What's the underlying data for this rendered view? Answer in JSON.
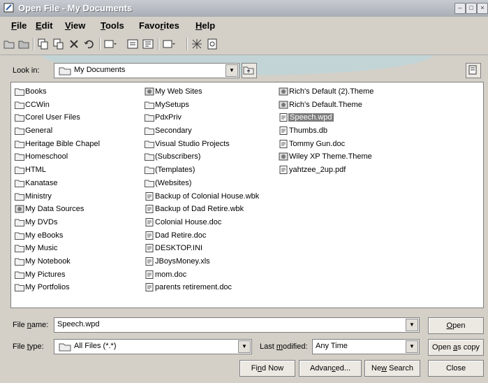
{
  "window": {
    "title": "Open File - My Documents"
  },
  "menu": [
    {
      "label": "File",
      "ul": "F",
      "rest": "ile"
    },
    {
      "label": "Edit",
      "ul": "E",
      "rest": "dit"
    },
    {
      "label": "View",
      "ul": "V",
      "rest": "iew"
    },
    {
      "label": "Tools",
      "ul": "T",
      "rest": "ools"
    },
    {
      "label": "Favorites",
      "pre": "Favo",
      "ul": "r",
      "rest": "ites"
    },
    {
      "label": "Help",
      "ul": "H",
      "rest": "elp"
    }
  ],
  "lookin": {
    "label": "Look in:",
    "value": "My Documents"
  },
  "files": {
    "col1": [
      "Books",
      "CCWin",
      "Corel User Files",
      "General",
      "Heritage Bible Chapel",
      "Homeschool",
      "HTML",
      "Kanatase",
      "Ministry",
      "My Data Sources",
      "My DVDs",
      "My eBooks",
      "My Music",
      "My Notebook",
      "My Pictures",
      "My Portfolios"
    ],
    "col2": [
      "My Web Sites",
      "MySetups",
      "PdxPriv",
      "Secondary",
      "Visual Studio Projects",
      "(Subscribers)",
      "(Templates)",
      "(Websites)",
      "Backup of Colonial House.wbk",
      "Backup of Dad Retire.wbk",
      "Colonial House.doc",
      "Dad Retire.doc",
      "DESKTOP.INI",
      "JBoysMoney.xls",
      "mom.doc",
      "parents retirement.doc"
    ],
    "col3": [
      "Rich's Default (2).Theme",
      "Rich's Default.Theme",
      "Speech.wpd",
      "Thumbs.db",
      "Tommy Gun.doc",
      "Wiley XP Theme.Theme",
      "yahtzee_2up.pdf"
    ]
  },
  "selected_file": "Speech.wpd",
  "filename": {
    "label_pre": "File ",
    "label_ul": "n",
    "label_post": "ame:",
    "value": "Speech.wpd"
  },
  "filetype": {
    "label_pre": "File ",
    "label_ul": "t",
    "label_post": "ype:",
    "value": "All Files (*.*)"
  },
  "lastmod": {
    "label_pre": "Last ",
    "label_ul": "m",
    "label_post": "odified:",
    "value": "Any Time"
  },
  "buttons": {
    "open_ul": "O",
    "open_rest": "pen",
    "opencopy_pre": "Open ",
    "opencopy_ul": "a",
    "opencopy_post": "s copy",
    "findnow_pre": "Fi",
    "findnow_ul": "n",
    "findnow_post": "d Now",
    "advanced_pre": "Advan",
    "advanced_ul": "c",
    "advanced_post": "ed...",
    "newsearch_pre": "Ne",
    "newsearch_ul": "w",
    "newsearch_post": " Search",
    "close": "Close"
  }
}
